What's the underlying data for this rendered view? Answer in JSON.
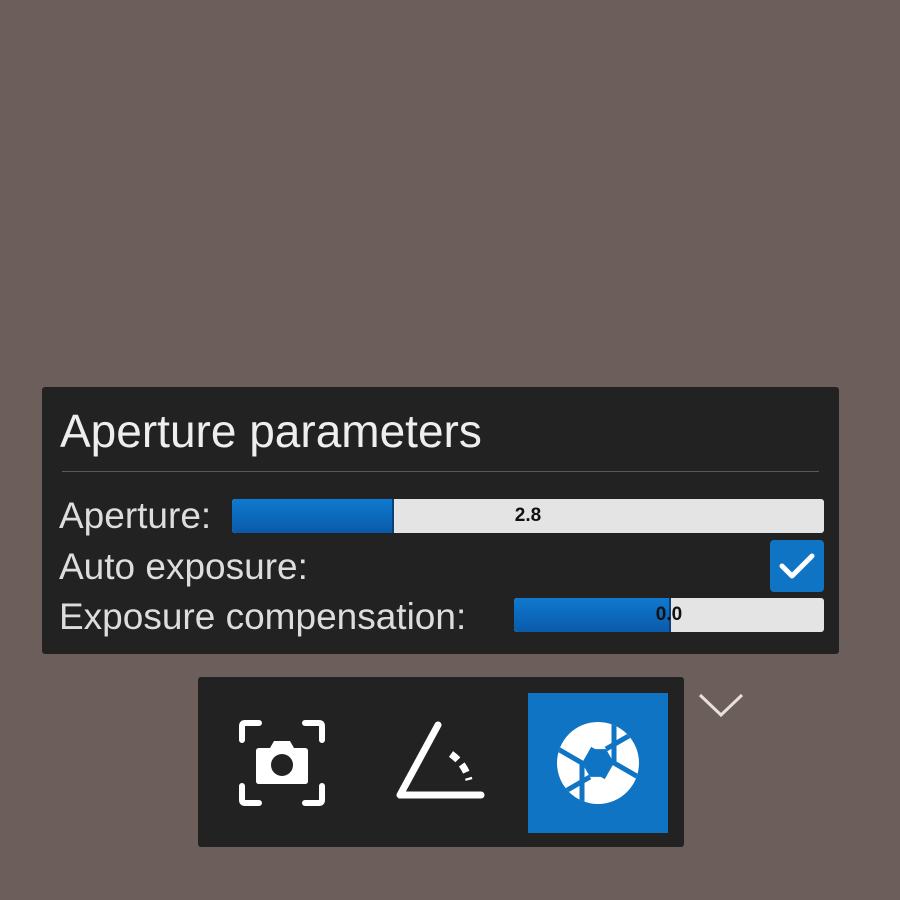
{
  "panel": {
    "title": "Aperture parameters",
    "aperture": {
      "label": "Aperture:",
      "value": "2.8",
      "fill_fraction": 0.27
    },
    "auto_exposure": {
      "label": "Auto exposure:",
      "checked": true
    },
    "exposure_compensation": {
      "label": "Exposure compensation:",
      "value": "0.0",
      "fill_fraction": 0.5
    }
  },
  "toolbar": {
    "buttons": [
      {
        "icon": "camera-focus-icon",
        "active": false
      },
      {
        "icon": "angle-icon",
        "active": false
      },
      {
        "icon": "aperture-shutter-icon",
        "active": true
      }
    ],
    "collapse_icon": "chevron-down-icon"
  },
  "colors": {
    "background": "#6b5e5b",
    "panel": "#222222",
    "accent": "#0f74c4",
    "track": "#e4e4e4"
  }
}
